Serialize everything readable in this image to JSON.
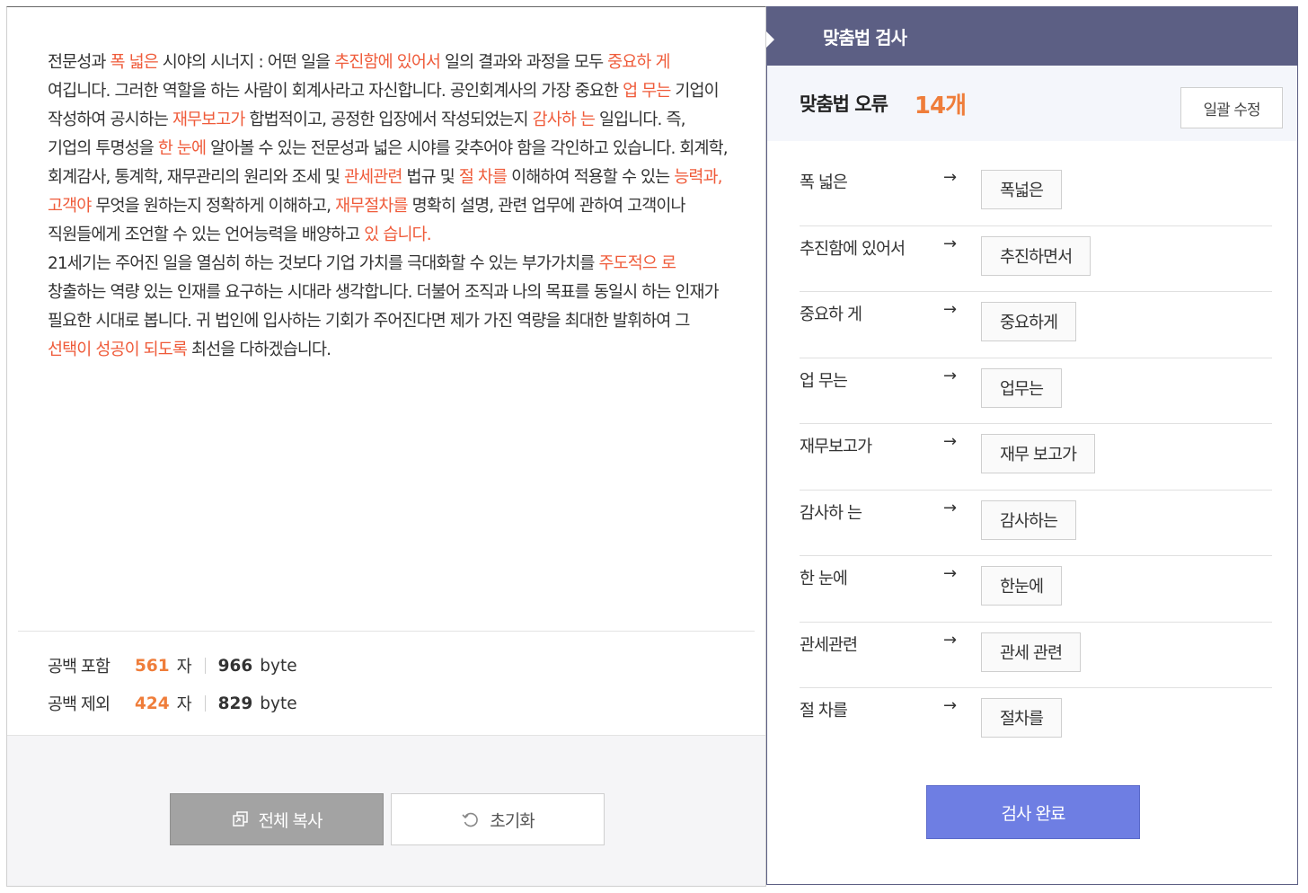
{
  "editor": {
    "segments": [
      {
        "t": "전문성과 ",
        "e": false
      },
      {
        "t": "폭 넓은",
        "e": true
      },
      {
        "t": " 시야의 시너지 : 어떤 일을 ",
        "e": false
      },
      {
        "t": "추진함에 있어서",
        "e": true
      },
      {
        "t": " 일의 결과와 과정을 모두 ",
        "e": false
      },
      {
        "t": "중요하 게",
        "e": true
      },
      {
        "t": " 여깁니다. 그러한 역할을 하는 사람이 회계사라고 자신합니다. 공인회계사의 가장 중요한 ",
        "e": false
      },
      {
        "t": "업 무는",
        "e": true
      },
      {
        "t": " 기업이 작성하여 공시하는 ",
        "e": false
      },
      {
        "t": "재무보고가",
        "e": true
      },
      {
        "t": " 합법적이고, 공정한 입장에서 작성되었는지 ",
        "e": false
      },
      {
        "t": "감사하 는",
        "e": true
      },
      {
        "t": " 일입니다. 즉, 기업의 투명성을 ",
        "e": false
      },
      {
        "t": "한 눈에",
        "e": true
      },
      {
        "t": " 알아볼 수 있는 전문성과 넓은 시야를 갖추어야 함을 각인하고 있습니다. 회계학, 회계감사, 통계학, 재무관리의 원리와 조세 및 ",
        "e": false
      },
      {
        "t": "관세관련",
        "e": true
      },
      {
        "t": " 법규 및 ",
        "e": false
      },
      {
        "t": "절 차를",
        "e": true
      },
      {
        "t": " 이해하여 적용할 수 있는 ",
        "e": false
      },
      {
        "t": "능력과, 고객야",
        "e": true
      },
      {
        "t": " 무엇을 원하는지 정확하게 이해하고, ",
        "e": false
      },
      {
        "t": "재무절차를",
        "e": true
      },
      {
        "t": " 명확히 설명, 관련 업무에 관하여 고객이나 직원들에게 조언할 수 있는 언어능력을 배양하고 ",
        "e": false
      },
      {
        "t": "있 습니다.",
        "e": true
      },
      {
        "t": "\n21세기는 주어진 일을 열심히 하는 것보다 기업 가치를 극대화할 수 있는 부가가치를 ",
        "e": false
      },
      {
        "t": "주도적으 로",
        "e": true
      },
      {
        "t": " 창출하는 역량 있는 인재를 요구하는 시대라 생각합니다. 더불어 조직과 나의 목표를 동일시 하는 인재가 필요한 시대로 봅니다. 귀 법인에 입사하는 기회가 주어진다면 제가 가진 역량을 최대한 발휘하여 그 ",
        "e": false
      },
      {
        "t": "선택이 성공이 되도록",
        "e": true
      },
      {
        "t": " 최선을 다하겠습니다.",
        "e": false
      }
    ],
    "error_color": "#ef5b3a"
  },
  "stats": {
    "with_space": {
      "label": "공백 포함",
      "chars": "561",
      "char_unit": "자",
      "bytes": "966",
      "byte_unit": "byte"
    },
    "without_space": {
      "label": "공백 제외",
      "chars": "424",
      "char_unit": "자",
      "bytes": "829",
      "byte_unit": "byte"
    }
  },
  "buttons": {
    "copy_all": "전체 복사",
    "reset": "초기화",
    "fix_all": "일괄 수정",
    "done": "검사 완료"
  },
  "panel": {
    "title": "맞춤법 검사",
    "error_label": "맞춤법 오류",
    "error_count": "14개"
  },
  "errors": [
    {
      "original": "폭 넓은",
      "suggestion": "폭넓은"
    },
    {
      "original": "추진함에 있어서",
      "suggestion": "추진하면서"
    },
    {
      "original": "중요하 게",
      "suggestion": "중요하게"
    },
    {
      "original": "업 무는",
      "suggestion": "업무는"
    },
    {
      "original": "재무보고가",
      "suggestion": "재무 보고가"
    },
    {
      "original": "감사하 는",
      "suggestion": "감사하는"
    },
    {
      "original": "한 눈에",
      "suggestion": "한눈에"
    },
    {
      "original": "관세관련",
      "suggestion": "관세 관련"
    },
    {
      "original": "절 차를",
      "suggestion": "절차를"
    }
  ],
  "arrow": "→",
  "colors": {
    "header": "#5c5f84",
    "accent": "#ef7d3a",
    "done": "#6e7ee3",
    "copy": "#a3a3a3"
  }
}
